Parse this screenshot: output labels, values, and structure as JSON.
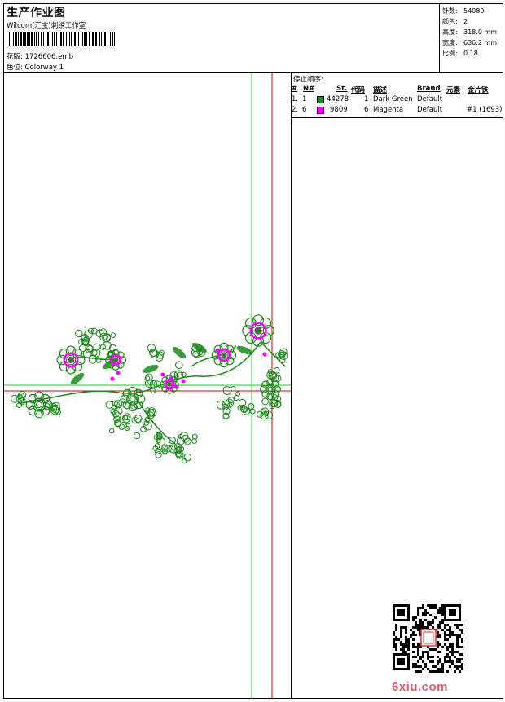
{
  "header": {
    "title": "生产作业图",
    "studio": "Wilcom(汇宝)刺绣工作室",
    "design_label": "花版:",
    "design_value": "1726606.emb",
    "colorway_label": "色位:",
    "colorway_value": "Colorway 1"
  },
  "stats": {
    "stitches_label": "针数:",
    "stitches_value": "54089",
    "colors_label": "颜色:",
    "colors_value": "2",
    "height_label": "高度:",
    "height_value": "318.0 mm",
    "width_label": "宽度:",
    "width_value": "636.2 mm",
    "scale_label": "比例:",
    "scale_value": "0.18"
  },
  "stop_sequence": {
    "title": "停止顺序:",
    "headers": {
      "num": "#",
      "needle": "N#",
      "st": "St.",
      "code": "代码",
      "desc": "描述",
      "brand": "Brand",
      "element": "元素",
      "sequin": "金片铁"
    },
    "rows": [
      {
        "num": "1.",
        "needle": "1",
        "color": "#1a8a1a",
        "st": "44278",
        "code": "1",
        "desc": "Dark Green",
        "brand": "Default",
        "extra": ""
      },
      {
        "num": "2.",
        "needle": "6",
        "color": "#ff00ff",
        "st": "9809",
        "code": "6",
        "desc": "Magenta",
        "brand": "Default",
        "extra": "#1 (1693)"
      }
    ]
  },
  "colors": {
    "green": "#1a8a1a",
    "magenta": "#ff00ff",
    "guide_green": "#22cc22",
    "guide_red": "#dd0000"
  },
  "watermark": {
    "text": "6xiu.com"
  }
}
